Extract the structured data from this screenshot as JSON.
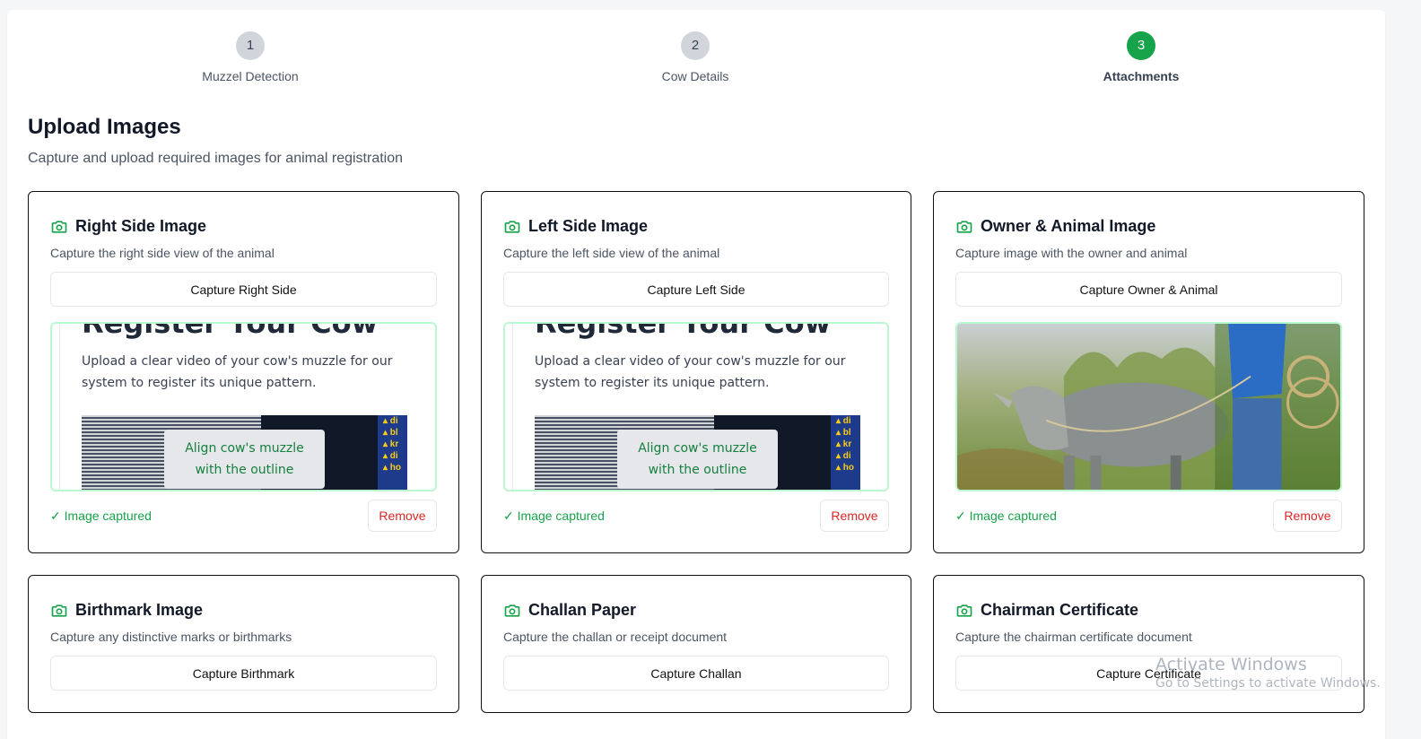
{
  "stepper": {
    "steps": [
      {
        "number": "1",
        "label": "Muzzel Detection",
        "state": "inactive"
      },
      {
        "number": "2",
        "label": "Cow Details",
        "state": "inactive"
      },
      {
        "number": "3",
        "label": "Attachments",
        "state": "active"
      }
    ]
  },
  "page": {
    "title": "Upload Images",
    "subtitle": "Capture and upload required images for animal registration"
  },
  "cards": [
    {
      "title": "Right Side Image",
      "description": "Capture the right side view of the animal",
      "button": "Capture Right Side",
      "status": "✓ Image captured",
      "remove": "Remove",
      "preview": {
        "heading": "Register Your Cow",
        "text": "Upload a clear video of your cow's muzzle for our system to register its unique pattern.",
        "bubble_line1": "Align cow's muzzle",
        "bubble_line2": "with the outline"
      }
    },
    {
      "title": "Left Side Image",
      "description": "Capture the left side view of the animal",
      "button": "Capture Left Side",
      "status": "✓ Image captured",
      "remove": "Remove",
      "preview": {
        "heading": "Register Your Cow",
        "text": "Upload a clear video of your cow's muzzle for our system to register its unique pattern.",
        "bubble_line1": "Align cow's muzzle",
        "bubble_line2": "with the outline"
      }
    },
    {
      "title": "Owner & Animal Image",
      "description": "Capture image with the owner and animal",
      "button": "Capture Owner & Animal",
      "status": "✓ Image captured",
      "remove": "Remove"
    },
    {
      "title": "Birthmark Image",
      "description": "Capture any distinctive marks or birthmarks",
      "button": "Capture Birthmark"
    },
    {
      "title": "Challan Paper",
      "description": "Capture the challan or receipt document",
      "button": "Capture Challan"
    },
    {
      "title": "Chairman Certificate",
      "description": "Capture the chairman certificate document",
      "button": "Capture Certificate"
    }
  ],
  "watermark": {
    "line1": "Activate Windows",
    "line2": "Go to Settings to activate Windows."
  },
  "colors": {
    "accent_green": "#16a34a",
    "remove_red": "#dc2626",
    "inactive_step": "#d1d5db"
  },
  "icons": {
    "card_icon": "camera-icon"
  }
}
